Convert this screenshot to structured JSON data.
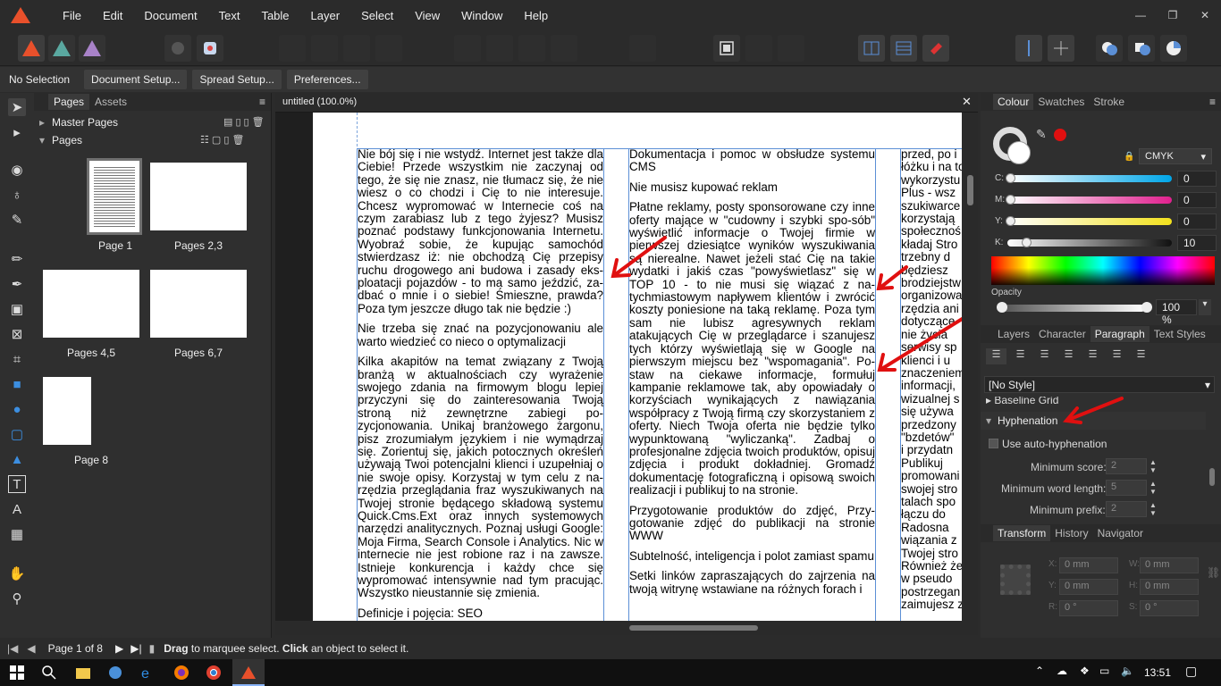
{
  "menu": [
    "File",
    "Edit",
    "Document",
    "Text",
    "Table",
    "Layer",
    "Select",
    "View",
    "Window",
    "Help"
  ],
  "window_controls": [
    "—",
    "❐",
    "✕"
  ],
  "context": {
    "selection": "No Selection",
    "buttons": [
      "Document Setup...",
      "Spread Setup...",
      "Preferences..."
    ]
  },
  "pages_panel": {
    "tabs": [
      "Pages",
      "Assets"
    ],
    "master_pages": "Master Pages",
    "pages": "Pages",
    "thumbs": [
      "Page 1",
      "Pages 2,3",
      "Pages 4,5",
      "Pages 6,7",
      "Page 8"
    ]
  },
  "document": {
    "tab": "untitled (100.0%)",
    "col1": [
      "Nie bój się i nie wstydź. Internet jest także dla Ciebie! Przede wszystkim nie zaczynaj od tego, że się nie znasz, nie tłumacz się, że nie wiesz o co chodzi i Cię to nie interesuje. Chcesz wypromować w Internecie coś na czym zarabiasz lub z tego żyjesz? Musisz poznać podstawy funkcjonowania Internetu. Wyobraź sobie, że kupując samochód stwierdzasz iż: nie obchodzą Cię przepisy ruchu drogowego ani budowa i zasady eks-ploatacji pojazdów - to ma samo jeździć, za-dbać o mnie i o siebie! Śmieszne, prawda? Poza tym jeszcze długo tak nie będzie :)",
      "Nie trzeba się znać na pozycjonowaniu ale warto wiedzieć co nieco o optymalizacji",
      "Kilka akapitów na temat związany z Twoją branżą w aktualnościach czy wyrażenie swojego zdania na firmowym blogu lepiej przyczyni się do zainteresowania Twoją stroną niż zewnętrzne zabiegi po-zycjonowania. Unikaj branżowego żargonu, pisz zrozumiałym językiem i nie wymądrzaj się. Zorientuj się, jakich potocznych określeń używają Twoi potencjalni klienci i uzupełniaj o nie swoje opisy. Korzystaj w tym celu z na-rzędzia przeglądania fraz wyszukiwanych na Twojej stronie będącego składową systemu Quick.Cms.Ext oraz innych systemowych narzędzi analitycznych. Poznaj usługi Google: Moja Firma, Search Console i Analytics. Nic w internecie nie jest robione raz i na zawsze. Istnieje konkurencja i każdy chce się wypromować intensywnie nad tym pracując. Wszystko nieustannie się zmienia.",
      "Definicje i pojęcia: SEO"
    ],
    "col2": [
      "Dokumentacja i pomoc w obsłudze systemu CMS",
      "Nie musisz kupować reklam",
      "Płatne reklamy, posty sponsorowane czy inne oferty mające w \"cudowny i szybki spo-sób\" wyświetlić informacje o Twojej firmie w pierwszej dziesiątce wyników wyszukiwania są nierealne. Nawet jeżeli stać Cię na takie wydatki i jakiś czas \"powyświetlasz\" się w TOP 10 - to nie musi się wiązać z na-tychmiastowym napływem klientów i zwrócić koszty poniesione na taką reklamę. Poza tym sam nie lubisz agresywnych reklam atakujących Cię w przeglądarce i szanujesz tych którzy wyświetlają się w Google na pierwszym miejscu bez \"wspomagania\". Po-staw na ciekawe informacje, formułuj kampanie reklamowe tak, aby opowiadały o korzyściach wynikających z nawiązania współpracy z Twoją firmą czy skorzystaniem z oferty. Niech Twoja oferta nie będzie tylko wypunktowaną \"wyliczanką\". Zadbaj o profesjonalne zdjęcia twoich produktów, opisuj zdjęcia i produkt dokładniej. Gromadź dokumentację fotograficzną i opisową swoich realizacji i publikuj to na stronie.",
      "Przygotowanie produktów do zdjęć, Przy-gotowanie zdjęć do publikacji na stronie WWW",
      "Subtelność, inteligencja i polot zamiast spamu",
      "Setki linków zapraszających do zajrzenia na twoją witrynę wstawiane na różnych forach i"
    ],
    "col3": [
      "przed, po i",
      "łóżku i na to",
      "wykorzystu",
      "Plus - wsz",
      "szukiwarce",
      "korzystają",
      "społecznoś",
      "kładaj Stro",
      "trzebny d",
      "będziesz",
      "brodziejstw",
      "organizowa",
      "rzędzia ani",
      "dotyczące",
      "nie życia",
      "serwisy sp",
      "klienci i u",
      "znaczeniem",
      "informacji,",
      "wizualnej s",
      "się używa",
      "przedzony",
      "\"bzdetów\"",
      "i przydatn",
      "Publikuj",
      "promowani",
      "swojej stro",
      "talach spo",
      "łączu do",
      "Radosna",
      "wiązania z",
      "Twojej stro",
      "Również że",
      "w pseudo",
      "postrzegan",
      "zaimujesz z"
    ]
  },
  "colour_panel": {
    "tabs": [
      "Colour",
      "Swatches",
      "Stroke"
    ],
    "model": "CMYK",
    "channels": [
      {
        "label": "C:",
        "value": "0"
      },
      {
        "label": "M:",
        "value": "0"
      },
      {
        "label": "Y:",
        "value": "0"
      },
      {
        "label": "K:",
        "value": "10"
      }
    ],
    "opacity_label": "Opacity",
    "opacity": "100 %"
  },
  "paragraph_panel": {
    "tabs": [
      "Layers",
      "Character",
      "Paragraph",
      "Text Styles"
    ],
    "style": "[No Style]",
    "section_cut": "Baseline Grid",
    "section": "Hyphenation",
    "auto_label": "Use auto-hyphenation",
    "fields": [
      {
        "label": "Minimum score:",
        "value": "2"
      },
      {
        "label": "Minimum word length:",
        "value": "5"
      },
      {
        "label": "Minimum prefix:",
        "value": "2"
      }
    ]
  },
  "transform_panel": {
    "tabs": [
      "Transform",
      "History",
      "Navigator"
    ],
    "fields": [
      {
        "label": "X:",
        "value": "0 mm"
      },
      {
        "label": "W:",
        "value": "0 mm"
      },
      {
        "label": "Y:",
        "value": "0 mm"
      },
      {
        "label": "H:",
        "value": "0 mm"
      },
      {
        "label": "R:",
        "value": "0 °"
      },
      {
        "label": "S:",
        "value": "0 °"
      }
    ]
  },
  "status": {
    "page": "Page 1 of 8",
    "hint_b1": "Drag",
    "hint_t1": " to marquee select. ",
    "hint_b2": "Click",
    "hint_t2": " an object to select it."
  },
  "taskbar": {
    "time": "13:51"
  },
  "colors": {
    "accent": "#2f7fd1",
    "arrow": "#e01010",
    "brand": "#e8502b"
  }
}
